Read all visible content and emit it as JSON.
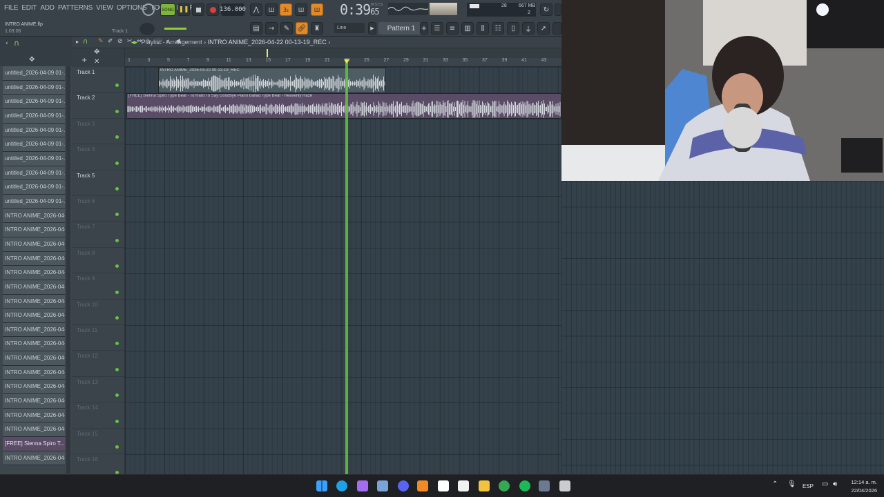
{
  "menu": [
    "FILE",
    "EDIT",
    "ADD",
    "PATTERNS",
    "VIEW",
    "OPTIONS",
    "TOOLS",
    "HELP"
  ],
  "project": {
    "name": "INTRO ANIME.flp",
    "time": "1:03:06",
    "hint_track": "Track 1"
  },
  "transport": {
    "song_mode": "SONG",
    "tempo": "136.000",
    "clock_main": "0:39",
    "clock_sub": "65",
    "clock_label": "M:S:CS",
    "snap": "Line",
    "pattern": "Pattern 1",
    "cpu_value": "28",
    "memory": "667 MB",
    "voices": "2"
  },
  "playlist": {
    "title": "Playlist - Arrangement",
    "current_clip": "INTRO ANIME_2026-04-22 00-13-19_REC",
    "ruler": [
      "1",
      "3",
      "5",
      "7",
      "9",
      "11",
      "13",
      "15",
      "17",
      "19",
      "21",
      "23",
      "25",
      "27",
      "29",
      "31",
      "33",
      "35",
      "37",
      "39",
      "41",
      "43"
    ],
    "tracks": [
      {
        "label": "Track 1",
        "active": true
      },
      {
        "label": "Track 2",
        "active": true
      },
      {
        "label": "Track 3",
        "active": false
      },
      {
        "label": "Track 4",
        "active": false
      },
      {
        "label": "Track 5",
        "active": true
      },
      {
        "label": "Track 6",
        "active": false
      },
      {
        "label": "Track 7",
        "active": false
      },
      {
        "label": "Track 8",
        "active": false
      },
      {
        "label": "Track 9",
        "active": false
      },
      {
        "label": "Track 10",
        "active": false
      },
      {
        "label": "Track 11",
        "active": false
      },
      {
        "label": "Track 12",
        "active": false
      },
      {
        "label": "Track 13",
        "active": false
      },
      {
        "label": "Track 14",
        "active": false
      },
      {
        "label": "Track 15",
        "active": false
      },
      {
        "label": "Track 16",
        "active": false
      }
    ],
    "clips": [
      {
        "name": "INTRO ANIME_2026-04-22 00-13-19_REC",
        "track": 1
      },
      {
        "name": "[FREE] Sienna Spiro Type Beat - To Hard To Say Goodbye  Piano Ballad Type Beat - Heavenly Haze",
        "track": 2
      }
    ]
  },
  "browser": {
    "items": [
      {
        "label": "untitled_2026-04-09 01-..."
      },
      {
        "label": "untitled_2026-04-09 01-..."
      },
      {
        "label": "untitled_2026-04-09 01-..."
      },
      {
        "label": "untitled_2026-04-09 01-..."
      },
      {
        "label": "untitled_2026-04-09 01-..."
      },
      {
        "label": "untitled_2026-04-09 01-..."
      },
      {
        "label": "untitled_2026-04-09 01-..."
      },
      {
        "label": "untitled_2026-04-09 01-..."
      },
      {
        "label": "untitled_2026-04-09 01-..."
      },
      {
        "label": "untitled_2026-04-09 01-..."
      },
      {
        "label": "INTRO ANIME_2026-04-0..."
      },
      {
        "label": "INTRO ANIME_2026-04-0..."
      },
      {
        "label": "INTRO ANIME_2026-04-0..."
      },
      {
        "label": "INTRO ANIME_2026-04-0..."
      },
      {
        "label": "INTRO ANIME_2026-04-0..."
      },
      {
        "label": "INTRO ANIME_2026-04-0..."
      },
      {
        "label": "INTRO ANIME_2026-04-0..."
      },
      {
        "label": "INTRO ANIME_2026-04-0..."
      },
      {
        "label": "INTRO ANIME_2026-04-0..."
      },
      {
        "label": "INTRO ANIME_2026-04-0..."
      },
      {
        "label": "INTRO ANIME_2026-04-2..."
      },
      {
        "label": "INTRO ANIME_2026-04-2..."
      },
      {
        "label": "INTRO ANIME_2026-04-2..."
      },
      {
        "label": "INTRO ANIME_2026-04-2..."
      },
      {
        "label": "INTRO ANIME_2026-04-2..."
      },
      {
        "label": "INTRO ANIME_2026-04-2..."
      },
      {
        "label": "[FREE] Sienna Spiro T..."
      },
      {
        "label": "INTRO ANIME_2026-04-2..."
      }
    ],
    "selected_index": 26
  },
  "taskbar": {
    "icons": [
      "windows-start-icon",
      "edge-icon",
      "copilot-icon",
      "vscode-icon",
      "discord-icon",
      "fl-studio-icon",
      "file-icon",
      "chatgpt-icon",
      "file-explorer-icon",
      "chrome-icon",
      "spotify-icon",
      "steam-icon",
      "settings-icon"
    ],
    "language": "ESP",
    "time": "12:14 a. m.",
    "date": "22/04/2026"
  },
  "colors": {
    "accent_orange": "#e28a2a",
    "playhead": "#5fbf3a",
    "clip1": "#4e5c64",
    "clip2": "#5a4b67"
  }
}
